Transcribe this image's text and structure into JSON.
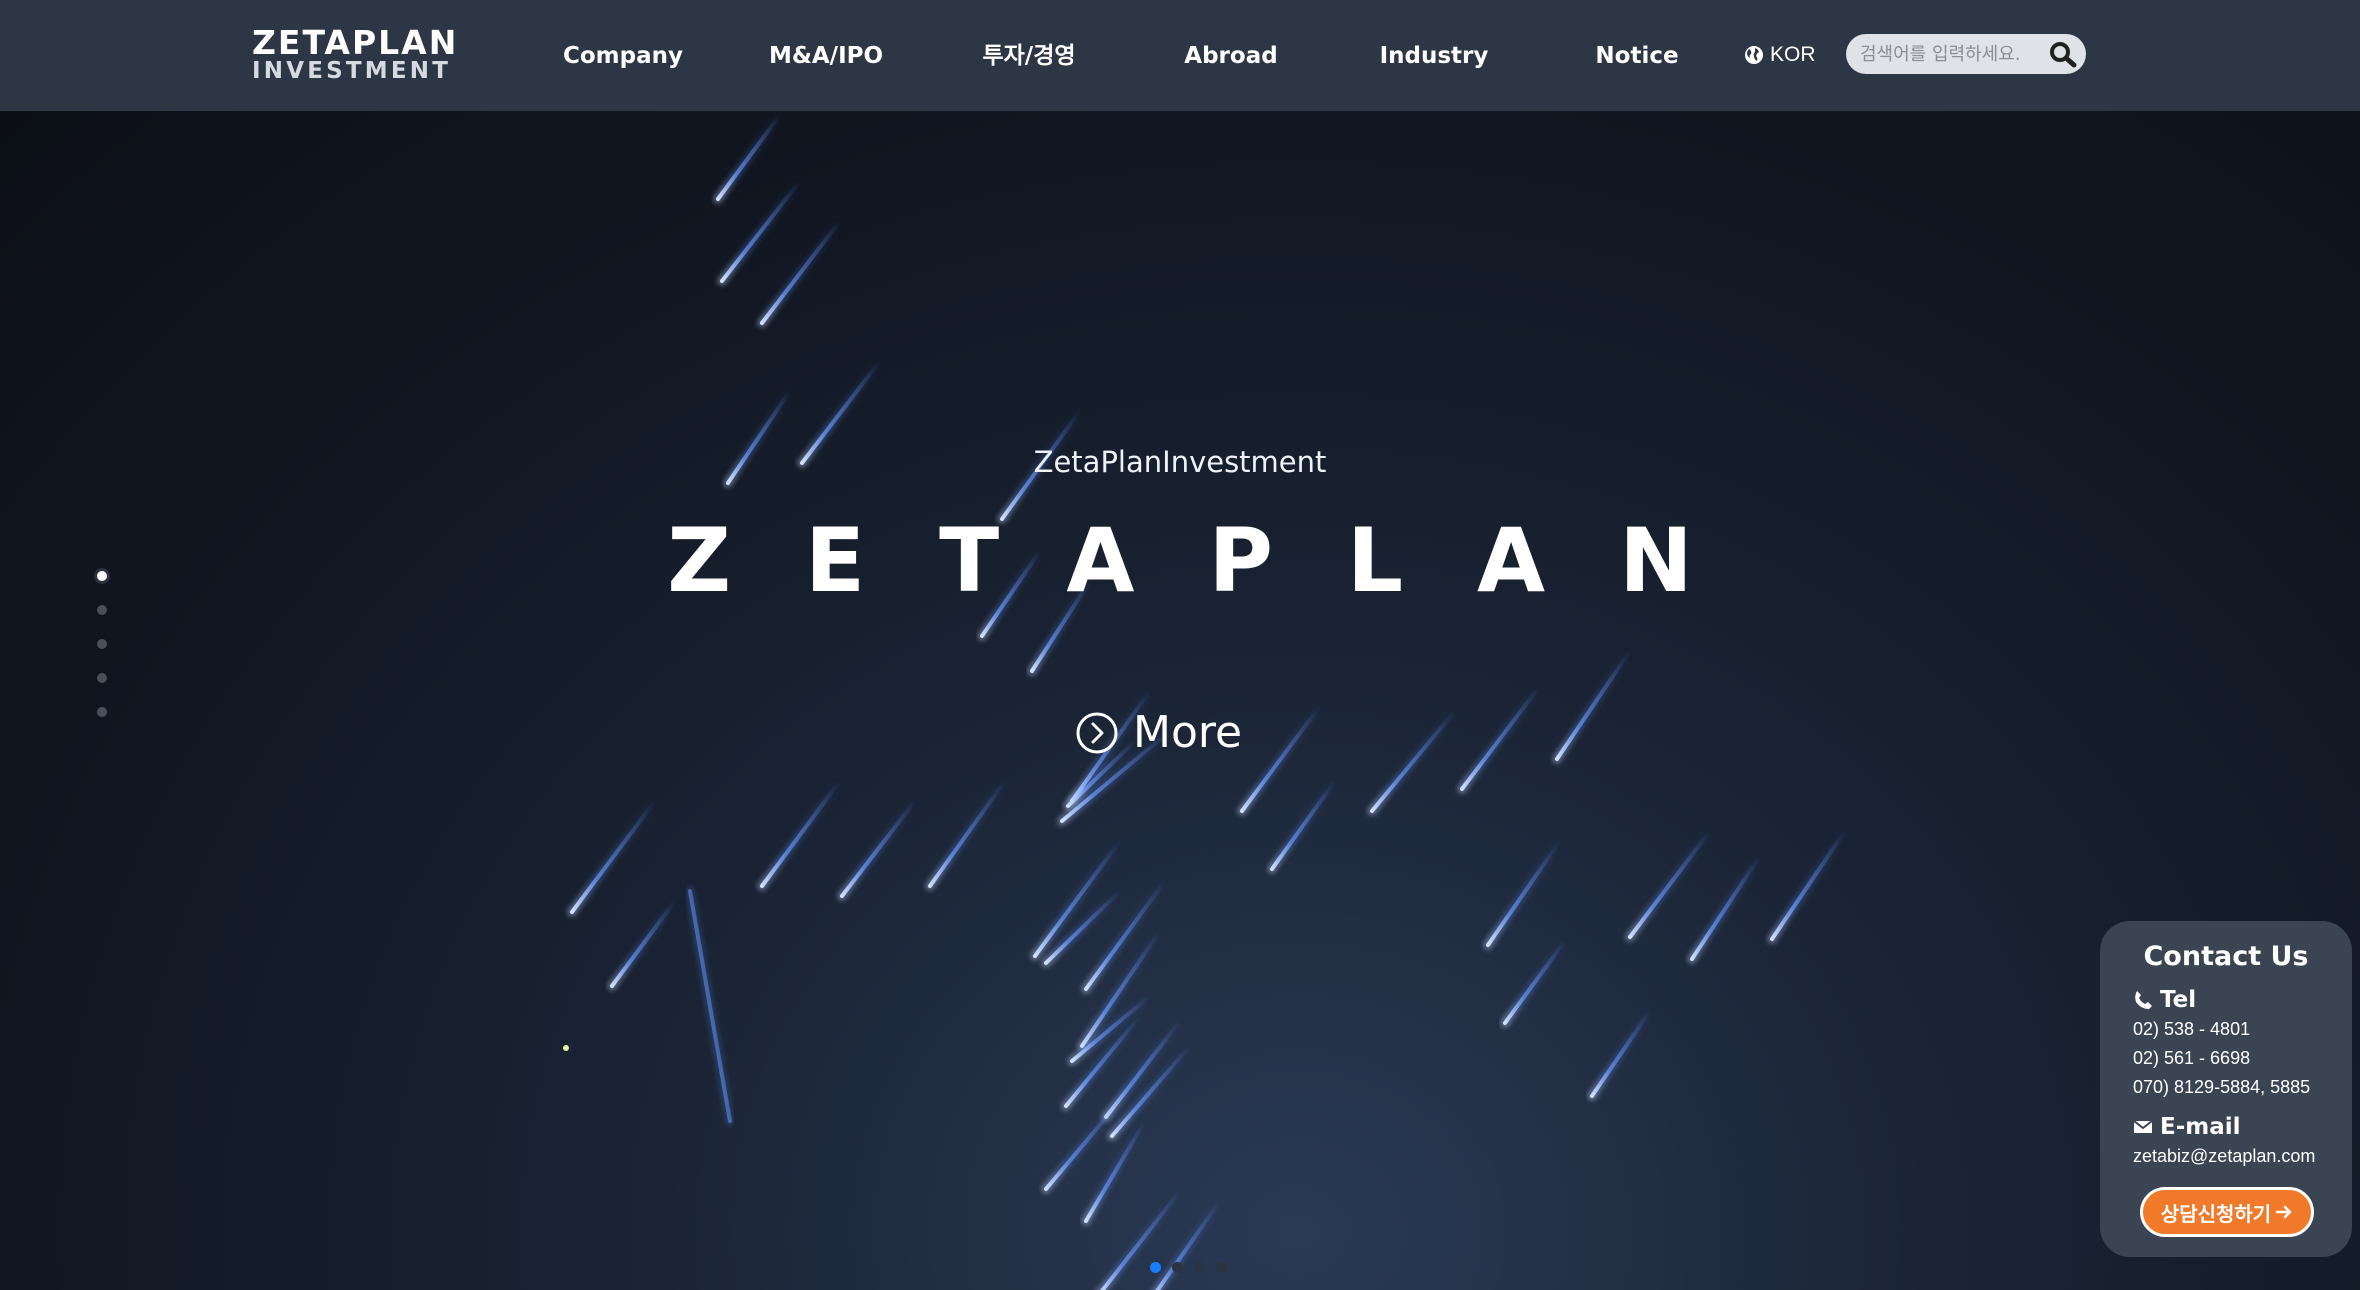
{
  "header": {
    "logo_top": "ZETAPLAN",
    "logo_bottom": "INVESTMENT",
    "nav": [
      "Company",
      "M&A/IPO",
      "투자/경영",
      "Abroad",
      "Industry",
      "Notice"
    ],
    "language": "KOR",
    "search_placeholder": "검색어를 입력하세요."
  },
  "hero": {
    "subtitle": "ZetaPlanInvestment",
    "title": "ZETAPLAN",
    "more_label": "More",
    "side_dots_count": 5,
    "side_dots_active": 0,
    "slide_dots_count": 4,
    "slide_dots_active": 0
  },
  "contact": {
    "title": "Contact Us",
    "tel_label": "Tel",
    "tel_lines": [
      "02) 538 - 4801",
      "02) 561 - 6698",
      "070) 8129-5884, 5885"
    ],
    "email_label": "E-mail",
    "email": "zetabiz@zetaplan.com",
    "button_label": "상담신청하기"
  },
  "colors": {
    "header_bg": "#2d3644",
    "accent_orange": "#f07a2a",
    "slide_dot_active": "#1a7cff",
    "streak": "#5a8dff"
  },
  "icons": {
    "language": "globe-icon",
    "search": "search-icon",
    "more": "chevron-circle-right-icon",
    "tel": "phone-icon",
    "email": "envelope-icon",
    "button": "arrow-right-icon"
  }
}
